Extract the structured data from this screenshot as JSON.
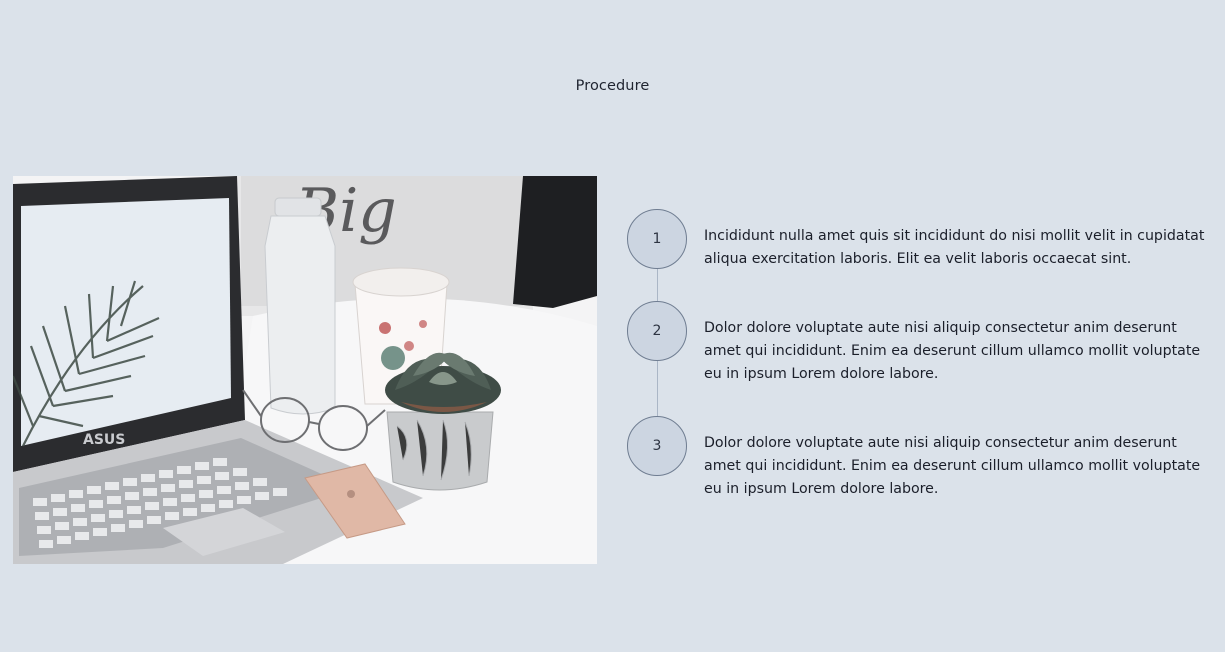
{
  "section": {
    "title": "Procedure"
  },
  "image": {
    "laptop_brand": "ASUS",
    "alt": "Laptop with succulent, coffee cup, glasses and phone on a white desk"
  },
  "steps": [
    {
      "number": "1",
      "text": "Incididunt nulla amet quis sit incididunt do nisi mollit velit in cupidatat aliqua exercitation laboris. Elit ea velit laboris occaecat sint."
    },
    {
      "number": "2",
      "text": "Dolor dolore voluptate aute nisi aliquip consectetur anim deserunt amet qui incididunt. Enim ea deserunt cillum ullamco mollit voluptate eu in ipsum Lorem dolore labore."
    },
    {
      "number": "3",
      "text": "Dolor dolore voluptate aute nisi aliquip consectetur anim deserunt amet qui incididunt. Enim ea deserunt cillum ullamco mollit voluptate eu in ipsum Lorem dolore labore."
    }
  ],
  "colors": {
    "background": "#dbe2ea",
    "step_circle_fill": "#ccd5e1",
    "step_circle_border": "#6f7d91",
    "connector": "#aab6c6",
    "text": "#1b1f2a"
  }
}
